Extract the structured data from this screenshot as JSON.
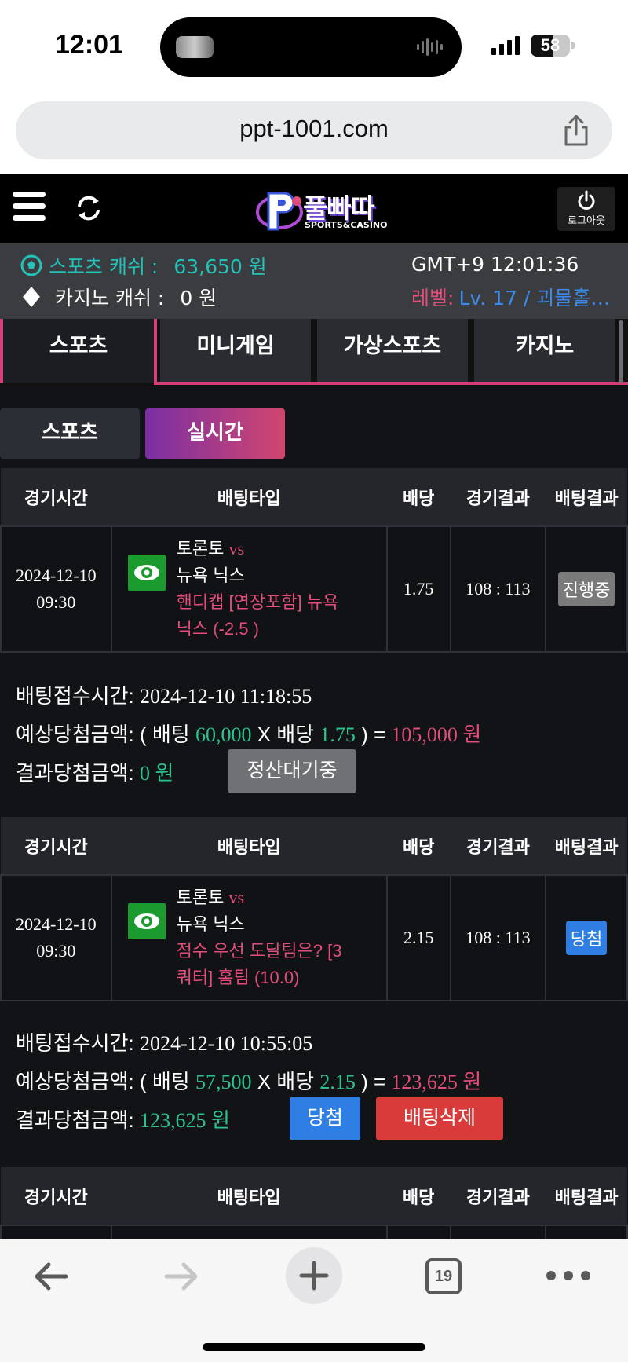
{
  "status_bar": {
    "time": "12:01",
    "battery": "58",
    "battery_level": 0.58
  },
  "browser": {
    "url": "ppt-1001.com",
    "tab_count": "19"
  },
  "header": {
    "logo_text": "풀빠따",
    "logo_sub": "SPORTS&CASINO",
    "logout_label": "로그아웃"
  },
  "account": {
    "sports_cash_label": "스포츠 캐쉬 :",
    "sports_cash_value": "63,650 원",
    "casino_cash_label": "카지노 캐쉬 :",
    "casino_cash_value": "0 원",
    "clock": "GMT+9 12:01:36",
    "level_label": "레벨:",
    "level_value": "Lv. 17 / 괴물홀…"
  },
  "main_tabs": [
    "스포츠",
    "미니게임",
    "가상스포츠",
    "카지노"
  ],
  "sub_tabs": [
    "스포츠",
    "실시간"
  ],
  "table_headers": [
    "경기시간",
    "배팅타입",
    "배당",
    "경기결과",
    "배팅결과"
  ],
  "bets": [
    {
      "date": "2024-12-10",
      "time": "09:30",
      "home": "토론토",
      "vs": "vs",
      "away": "뉴욕 닉스",
      "bet_line_1": "핸디캡 [연장포함] 뉴욕",
      "bet_line_2": "닉스 (-2.5 )",
      "odds": "1.75",
      "score": "108 : 113",
      "status": "진행중",
      "received_label": "배팅접수시간:",
      "received_time": "2024-12-10 11:18:55",
      "expected_label": "예상당첨금액:",
      "expected_open": "( 배팅",
      "stake": "60,000",
      "x_odds": "X 배당",
      "expected_close": ") =",
      "expected_win": "105,000 원",
      "result_label": "결과당첨금액:",
      "result_amount": "0 원",
      "action_button": "정산대기중"
    },
    {
      "date": "2024-12-10",
      "time": "09:30",
      "home": "토론토",
      "vs": "vs",
      "away": "뉴욕 닉스",
      "bet_line_1": "점수 우선 도달팀은? [3",
      "bet_line_2": "쿼터] 홈팀 (10.0)",
      "odds": "2.15",
      "score": "108 : 113",
      "status": "당첨",
      "received_label": "배팅접수시간:",
      "received_time": "2024-12-10 10:55:05",
      "expected_label": "예상당첨금액:",
      "expected_open": "( 배팅",
      "stake": "57,500",
      "x_odds": "X 배당",
      "expected_close": ") =",
      "expected_win": "123,625 원",
      "result_label": "결과당첨금액:",
      "result_amount": "123,625 원",
      "win_button": "당첨",
      "delete_button": "배팅삭제"
    }
  ],
  "colors": {
    "accent_pink": "#d63e7a",
    "teal": "#22c2b8",
    "green": "#28c48d",
    "win_blue": "#2f7ee4",
    "delete_red": "#d93a3a"
  },
  "icons": [
    "hamburger-icon",
    "refresh-icon",
    "power-icon",
    "eye-icon",
    "share-icon",
    "back-arrow-icon",
    "forward-arrow-icon",
    "plus-icon",
    "more-icon",
    "soccer-ball-icon",
    "diamond-icon"
  ]
}
